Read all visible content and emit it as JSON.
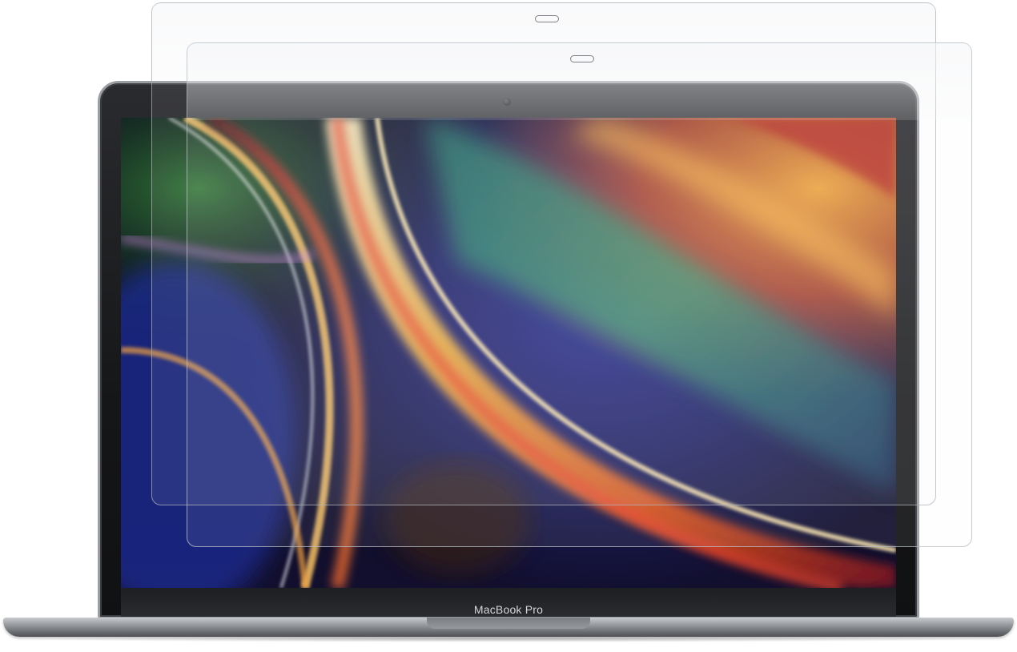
{
  "product": {
    "device_label": "MacBook Pro"
  },
  "scene": {
    "protector_film_count": 2,
    "colors": {
      "background": "#ffffff",
      "bezel": "#151618",
      "aluminum": "#9b9ea3",
      "wallpaper_blue": "#2b2f8f",
      "wallpaper_orange": "#f39a2c",
      "wallpaper_red": "#c8302a"
    },
    "icons": [
      "camera-icon",
      "film-tab-slot-icon"
    ]
  }
}
